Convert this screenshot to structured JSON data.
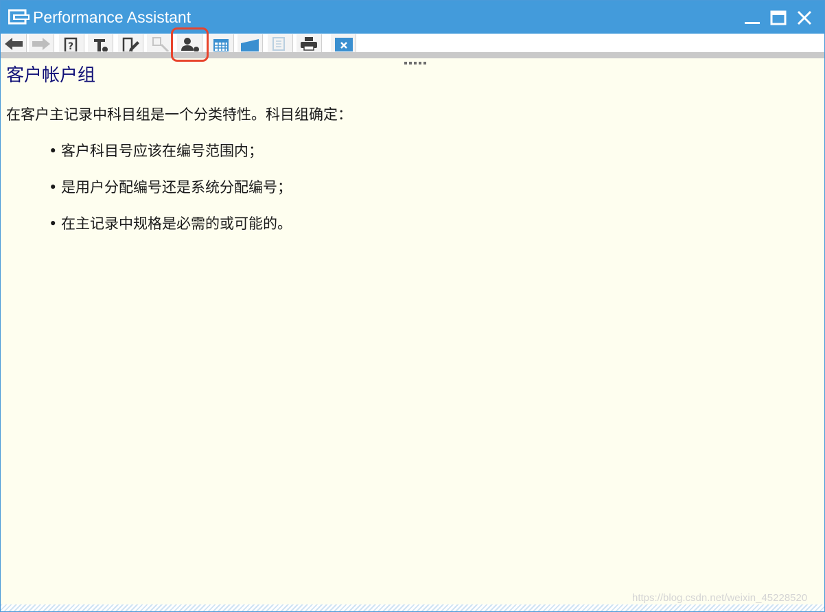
{
  "window": {
    "title": "Performance Assistant",
    "title_bar_color": "#439bdb",
    "controls": [
      "minimize-icon",
      "maximize-icon",
      "close-icon"
    ]
  },
  "toolbar": {
    "buttons": [
      {
        "name": "back-button",
        "icon": "arrow-left-icon",
        "enabled": true
      },
      {
        "name": "forward-button",
        "icon": "arrow-right-icon",
        "enabled": false
      },
      {
        "name": "help-info-button",
        "icon": "question-document-icon",
        "enabled": true
      },
      {
        "name": "technical-info-button",
        "icon": "tool-icon",
        "enabled": true
      },
      {
        "name": "edit-button",
        "icon": "document-pencil-icon",
        "enabled": true
      },
      {
        "name": "glossary-button",
        "icon": "document-search-icon",
        "enabled": false
      },
      {
        "name": "user-settings-button",
        "icon": "user-settings-icon",
        "enabled": true,
        "highlighted": true
      },
      {
        "name": "calendar-button",
        "icon": "calendar-icon",
        "enabled": true
      },
      {
        "name": "bookmark-button",
        "icon": "flag-icon",
        "enabled": true
      },
      {
        "name": "export-button",
        "icon": "document-arrow-icon",
        "enabled": false
      },
      {
        "name": "print-button",
        "icon": "printer-icon",
        "enabled": true
      },
      {
        "name": "close-pane-button",
        "icon": "close-box-icon",
        "enabled": true
      }
    ],
    "highlight_color": "#e8442c"
  },
  "content": {
    "heading": "客户帐户组",
    "intro": "在客户主记录中科目组是一个分类特性。科目组确定：",
    "bullets": [
      "客户科目号应该在编号范围内；",
      "是用户分配编号还是系统分配编号；",
      "在主记录中规格是必需的或可能的。"
    ],
    "background_color": "#fefeef",
    "heading_color": "#101077"
  },
  "watermark": "https://blog.csdn.net/weixin_45228520"
}
